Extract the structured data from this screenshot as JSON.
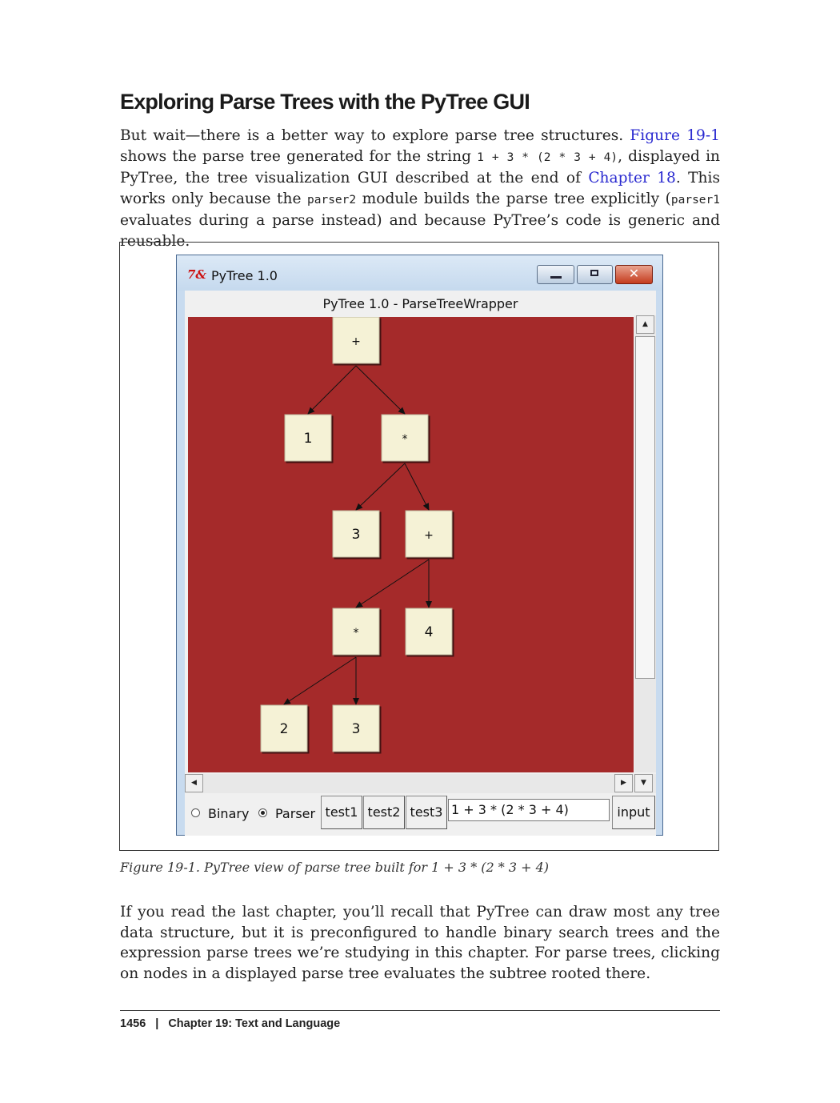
{
  "heading": "Exploring Parse Trees with the PyTree GUI",
  "para1": {
    "t1": "But wait—there is a better way to explore parse tree structures. ",
    "fig_link": "Figure 19-1",
    "t2": " shows the parse tree generated for the string ",
    "code1": "1 + 3 * (2 * 3 + 4)",
    "t3": ", displayed in PyTree, the tree visualization GUI described at the end of ",
    "chapter_link": "Chapter 18",
    "t4": ". This works only because the ",
    "code2": "parser2",
    "t5": " module builds the parse tree explicitly (",
    "code3": "parser1",
    "t6": " evaluates during a parse instead) and because PyTree’s code is generic and reusable."
  },
  "window": {
    "title": "PyTree 1.0",
    "icon": "tk-feather-icon",
    "subtitle": "PyTree 1.0 - ParseTreeWrapper",
    "tree": {
      "nodes": [
        {
          "id": "n0",
          "label": "+"
        },
        {
          "id": "n1",
          "label": "1"
        },
        {
          "id": "n2",
          "label": "*"
        },
        {
          "id": "n3",
          "label": "3"
        },
        {
          "id": "n4",
          "label": "+"
        },
        {
          "id": "n5",
          "label": "*"
        },
        {
          "id": "n6",
          "label": "4"
        },
        {
          "id": "n7",
          "label": "2"
        },
        {
          "id": "n8",
          "label": "3"
        }
      ],
      "edges": [
        [
          "n0",
          "n1"
        ],
        [
          "n0",
          "n2"
        ],
        [
          "n2",
          "n3"
        ],
        [
          "n2",
          "n4"
        ],
        [
          "n4",
          "n5"
        ],
        [
          "n4",
          "n6"
        ],
        [
          "n5",
          "n7"
        ],
        [
          "n5",
          "n8"
        ]
      ]
    },
    "radio_binary": "Binary",
    "radio_parser": "Parser",
    "selected_mode": "Parser",
    "buttons": [
      "test1",
      "test2",
      "test3"
    ],
    "input_value": "1 + 3 * (2 * 3 + 4)",
    "input_button": "input",
    "colors": {
      "canvas": "#a52a2a",
      "node": "#f5f2d6"
    }
  },
  "caption": "Figure 19-1. PyTree view of parse tree built for 1 + 3 * (2 * 3 + 4)",
  "para2": "If you read the last chapter, you’ll recall that PyTree can draw most any tree data structure, but it is preconfigured to handle binary search trees and the expression parse trees we’re studying in this chapter. For parse trees, clicking on nodes in a displayed parse tree evaluates the subtree rooted there.",
  "footer": {
    "page": "1456",
    "chapter": "Chapter 19:  Text and Language"
  }
}
